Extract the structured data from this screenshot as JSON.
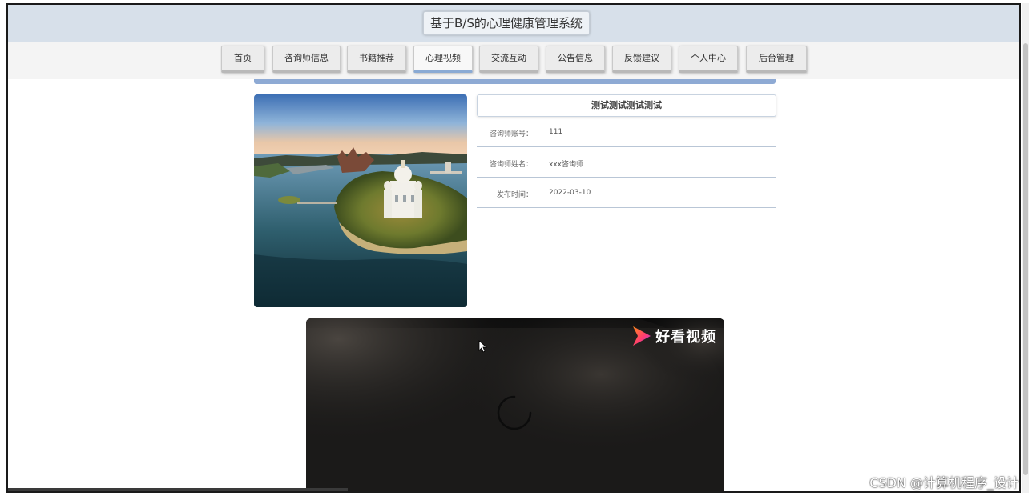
{
  "header": {
    "title": "基于B/S的心理健康管理系统"
  },
  "nav": {
    "items": [
      {
        "label": "首页"
      },
      {
        "label": "咨询师信息"
      },
      {
        "label": "书籍推荐"
      },
      {
        "label": "心理视频"
      },
      {
        "label": "交流互动"
      },
      {
        "label": "公告信息"
      },
      {
        "label": "反馈建议"
      },
      {
        "label": "个人中心"
      },
      {
        "label": "后台管理"
      }
    ],
    "active_index": 3
  },
  "detail": {
    "title": "测试测试测试测试",
    "rows": [
      {
        "label": "咨询师账号：",
        "value": "111"
      },
      {
        "label": "咨询师姓名：",
        "value": "xxx咨询师"
      },
      {
        "label": "发布时间：",
        "value": "2022-03-10"
      }
    ]
  },
  "video": {
    "logo_text": "好看视频"
  },
  "watermark": "CSDN @计算机程序_设计",
  "colors": {
    "header_bg": "#d7e0ea",
    "accent_blue": "#8eaad4",
    "logo_orange": "#ff7a1a",
    "logo_purple": "#c034e6"
  }
}
